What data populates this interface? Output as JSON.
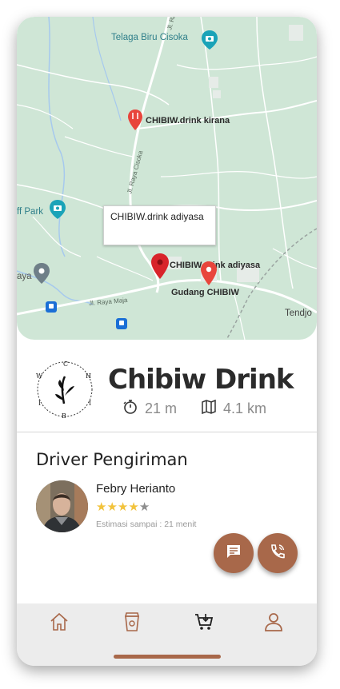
{
  "map": {
    "labels": {
      "telaga": "Telaga Biru Cisoka",
      "kirana": "CHIBIW.drink kirana",
      "park": "ff Park",
      "adiyasa": "CHIBIW.drink adiyasa",
      "gudang": "Gudang CHIBIW",
      "tendjo": "Tendjo",
      "aya": "aya",
      "road_cisoka": "Jl. Raya Cisoka",
      "road_maja": "Jl. Raya Maja",
      "road_top": "Jl. Ra"
    },
    "infobox_text": "CHIBIW.drink adiyasa"
  },
  "store": {
    "name": "Chibiw Drink",
    "logo_letters": {
      "c": "C",
      "w": "W",
      "h": "H",
      "i1": "I",
      "i2": "I",
      "b": "B"
    },
    "time": "21 m",
    "distance": "4.1 km",
    "time_icon": "stopwatch-icon",
    "distance_icon": "map-icon"
  },
  "driver": {
    "section_title": "Driver Pengiriman",
    "name": "Febry Herianto",
    "rating": 4,
    "rating_max": 5,
    "eta": "Estimasi sampai : 21 menit"
  },
  "actions": {
    "chat_icon": "chat-icon",
    "call_icon": "phone-call-icon"
  },
  "nav": {
    "items": [
      "home-icon",
      "coffee-cup-icon",
      "cart-icon",
      "user-icon"
    ]
  },
  "colors": {
    "accent": "#a8684a",
    "map_bg": "#cfe6d6",
    "star": "#f2c33c"
  }
}
